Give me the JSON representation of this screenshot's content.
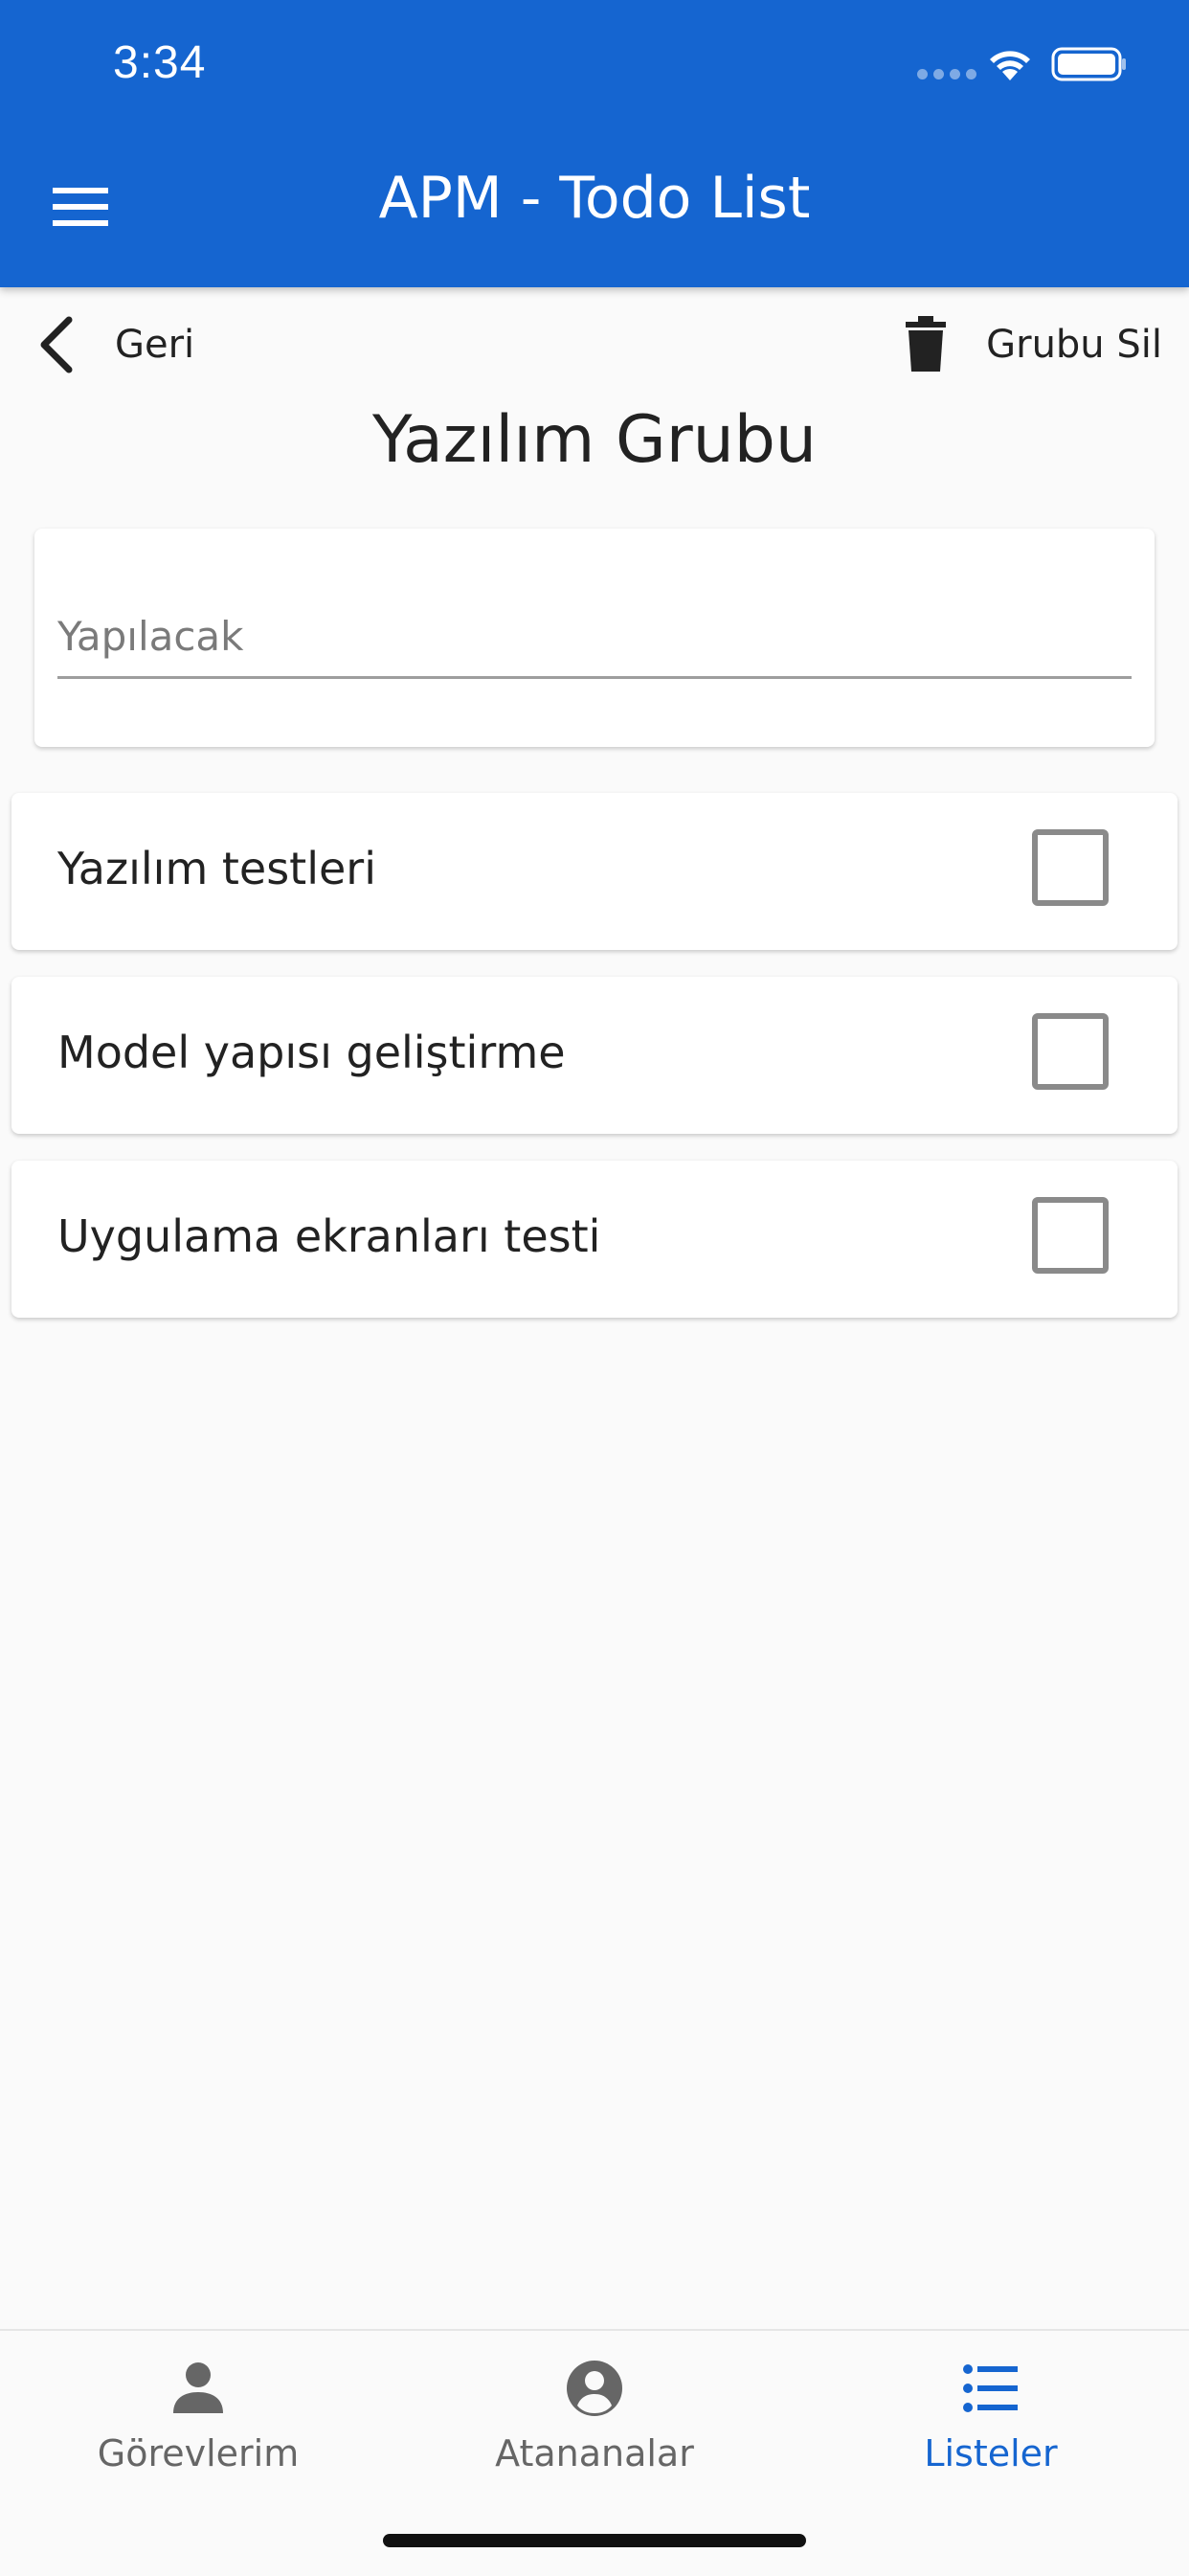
{
  "status_bar": {
    "time": "3:34"
  },
  "app_bar": {
    "title": "APM - Todo List"
  },
  "toolbar": {
    "back_label": "Geri",
    "delete_label": "Grubu Sil"
  },
  "page": {
    "title": "Yazılım Grubu"
  },
  "todo_input": {
    "placeholder": "Yapılacak",
    "value": ""
  },
  "todos": [
    {
      "text": "Yazılım testleri",
      "checked": false
    },
    {
      "text": "Model yapısı geliştirme",
      "checked": false
    },
    {
      "text": "Uygulama ekranları testi",
      "checked": false
    }
  ],
  "tabs": [
    {
      "label": "Görevlerim",
      "icon": "person-icon",
      "active": false
    },
    {
      "label": "Atananalar",
      "icon": "account-circle-icon",
      "active": false
    },
    {
      "label": "Listeler",
      "icon": "list-icon",
      "active": true
    }
  ],
  "colors": {
    "primary": "#1565d0",
    "inactive_tab": "#666666",
    "checkbox_border": "#8a8a8a"
  }
}
